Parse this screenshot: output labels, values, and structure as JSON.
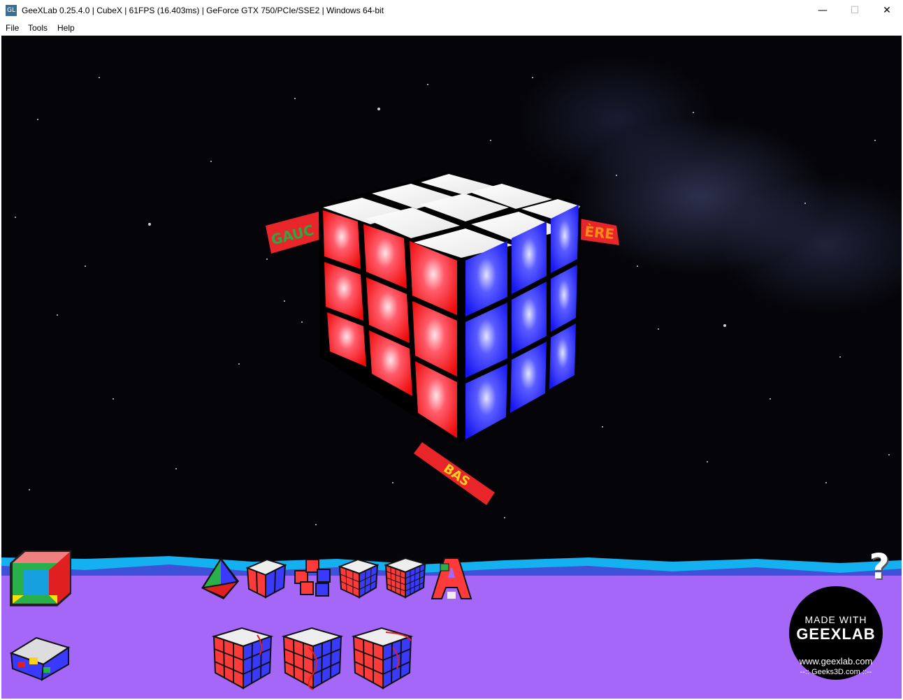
{
  "window": {
    "title": "GeeXLab 0.25.4.0 | CubeX | 61FPS (16.403ms) | GeForce GTX 750/PCIe/SSE2 | Windows 64-bit",
    "app_icon_label": "GL",
    "minimize": "—",
    "maximize": "☐",
    "close": "✕"
  },
  "menu": {
    "file": "File",
    "tools": "Tools",
    "help": "Help"
  },
  "scene": {
    "labels": {
      "left": "GAUC",
      "right": "ÈRE",
      "bottom": "BAS"
    },
    "colors": {
      "front": "#ff2020",
      "right": "#2a2aff",
      "top": "#ffffff",
      "label_bg": "#e8262a",
      "label_left": "#29a847",
      "label_right": "#ff8c1a",
      "label_bottom": "#ffd21a"
    }
  },
  "panel": {
    "help_glyph": "?",
    "thumbnails_row1": [
      "pyramid-puzzle",
      "cube-2x2",
      "cube-multi",
      "cube-3x3",
      "cube-4x4",
      "letter-a-cube"
    ],
    "thumbnails_row2": [
      "cube-sequence-1",
      "cube-sequence-2",
      "cube-sequence-3"
    ],
    "badge": {
      "made_with": "MADE WITH",
      "brand": "GEEXLAB",
      "url": "www.geexlab.com",
      "geeks": "--:: Geeks3D.com ::--"
    }
  }
}
